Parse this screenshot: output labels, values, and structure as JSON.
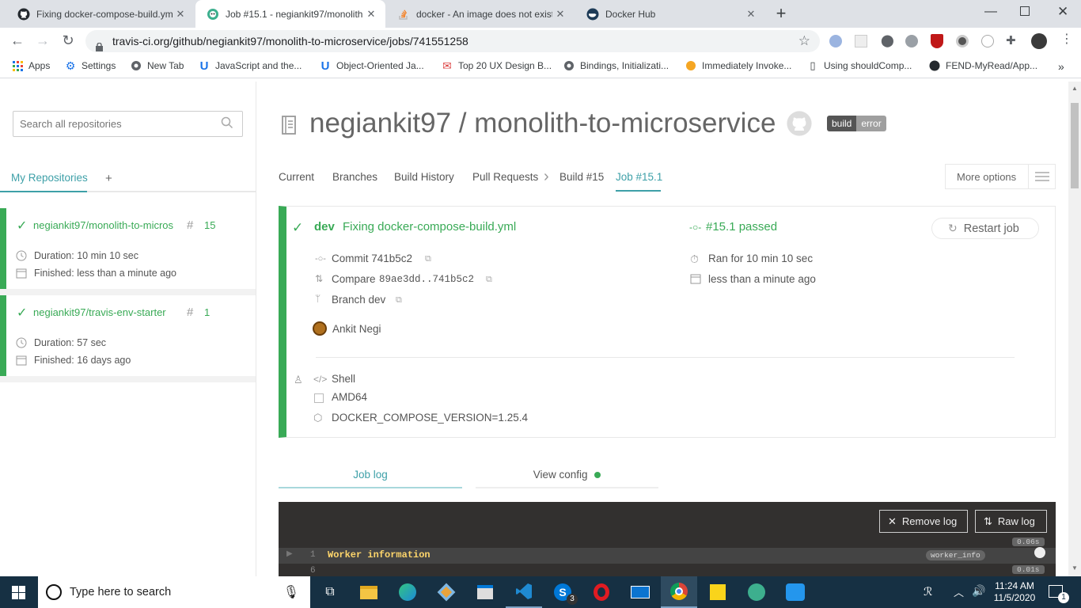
{
  "browser": {
    "tabs": [
      {
        "title": "Fixing docker-compose-build.ym",
        "icon": "github-icon",
        "active": false
      },
      {
        "title": "Job #15.1 - negiankit97/monolith",
        "icon": "travis-icon",
        "active": true
      },
      {
        "title": "docker - An image does not exist",
        "icon": "stackoverflow-icon",
        "active": false
      },
      {
        "title": "Docker Hub",
        "icon": "docker-icon",
        "active": false
      }
    ],
    "url": "travis-ci.org/github/negiankit97/monolith-to-microservice/jobs/741551258",
    "bookmarks": [
      "Apps",
      "Settings",
      "New Tab",
      "JavaScript and the...",
      "Object-Oriented Ja...",
      "Top 20 UX Design B...",
      "Bindings, Initializati...",
      "Immediately Invoke...",
      "Using shouldComp...",
      "FEND-MyRead/App..."
    ]
  },
  "sidebar": {
    "search_placeholder": "Search all repositories",
    "tab_label": "My Repositories",
    "add_label": "+",
    "repos": [
      {
        "name": "negiankit97/monolith-to-micros",
        "number": "15",
        "duration": "Duration: 10 min 10 sec",
        "finished": "Finished: less than a minute ago"
      },
      {
        "name": "negiankit97/travis-env-starter",
        "number": "1",
        "duration": "Duration: 57 sec",
        "finished": "Finished: 16 days ago"
      }
    ]
  },
  "repo": {
    "title": "negiankit97 / monolith-to-microservice",
    "badge_left": "build",
    "badge_right": "error"
  },
  "subnav": {
    "items": [
      "Current",
      "Branches",
      "Build History",
      "Pull Requests",
      "Build #15",
      "Job #15.1"
    ],
    "more_options": "More options"
  },
  "job": {
    "branch": "dev",
    "commit_message": "Fixing docker-compose-build.yml",
    "status": "#15.1 passed",
    "restart": "Restart job",
    "commit": "Commit 741b5c2",
    "compare_label": "Compare",
    "compare_range": "89ae3dd..741b5c2",
    "branch_label": "Branch dev",
    "author": "Ankit Negi",
    "ran_for": "Ran for 10 min 10 sec",
    "finished": "less than a minute ago",
    "language": "Shell",
    "arch": "AMD64",
    "env": "DOCKER_COMPOSE_VERSION=1.25.4"
  },
  "log_tabs": {
    "job_log": "Job log",
    "view_config": "View config"
  },
  "log": {
    "remove": "Remove log",
    "raw": "Raw log",
    "line1_num": "1",
    "line1_text": "Worker information",
    "line1_tag": "worker_info",
    "line1_time": "0.06s",
    "line2_num": "6",
    "line2_time": "0.01s"
  },
  "taskbar": {
    "search_placeholder": "Type here to search",
    "time": "11:24 AM",
    "date": "11/5/2020",
    "notification_count": "1",
    "skype_badge": "3"
  },
  "colors": {
    "green": "#39aa56",
    "teal": "#3ea0a8",
    "taskbar": "#163043"
  }
}
